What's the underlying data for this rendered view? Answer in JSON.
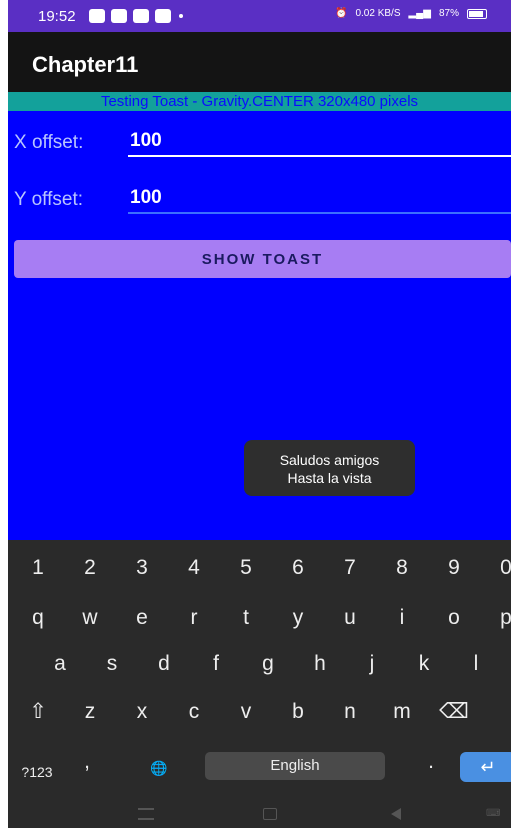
{
  "status_bar": {
    "time": "19:52",
    "right_text": "0.02 KB/S",
    "battery": "87%"
  },
  "app_bar": {
    "title": "Chapter11"
  },
  "subtitle": "Testing Toast - Gravity.CENTER 320x480 pixels",
  "form": {
    "x_label": "X offset:",
    "x_value": "100",
    "y_label": "Y offset:",
    "y_value": "100",
    "button_label": "SHOW TOAST"
  },
  "toast": {
    "line1": "Saludos amigos",
    "line2": "Hasta la vista"
  },
  "keyboard": {
    "row1": [
      "1",
      "2",
      "3",
      "4",
      "5",
      "6",
      "7",
      "8",
      "9",
      "0"
    ],
    "row2": [
      "q",
      "w",
      "e",
      "r",
      "t",
      "y",
      "u",
      "i",
      "o",
      "p"
    ],
    "row3": [
      "a",
      "s",
      "d",
      "f",
      "g",
      "h",
      "j",
      "k",
      "l"
    ],
    "row4": [
      "⇧",
      "z",
      "x",
      "c",
      "v",
      "b",
      "n",
      "m",
      "⌫"
    ],
    "symbols_label": "?123",
    "comma": ",",
    "globe": "🌐",
    "space_label": "English",
    "period": ".",
    "enter": "↵"
  },
  "colors": {
    "background": "#0000ff",
    "accent": "#a77df3",
    "subtitle_bg": "#13a19b"
  }
}
